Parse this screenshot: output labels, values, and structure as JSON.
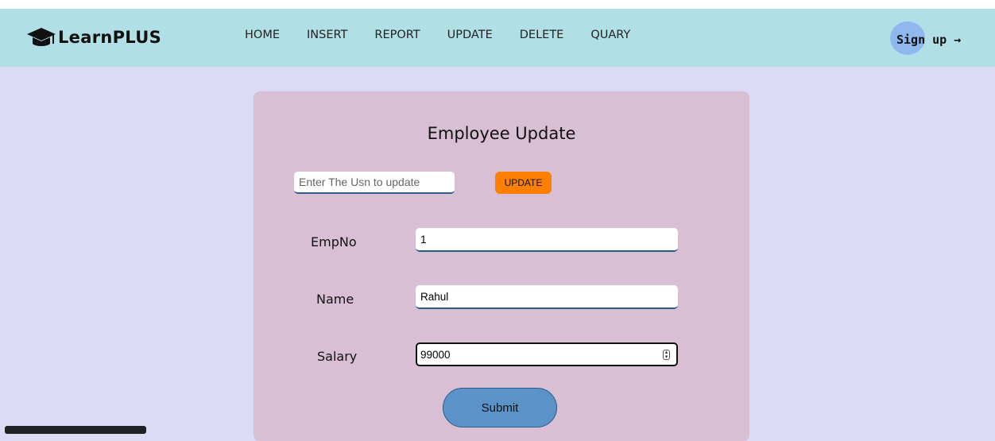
{
  "brand": {
    "name": "LearnPLUS",
    "icon": "graduation-cap-icon"
  },
  "nav": {
    "items": [
      "HOME",
      "INSERT",
      "REPORT",
      "UPDATE",
      "DELETE",
      "QUARY"
    ]
  },
  "signup": {
    "label": "Sign up →"
  },
  "form": {
    "title": "Employee Update",
    "usn_placeholder": "Enter The Usn to update",
    "update_label": "UPDATE",
    "fields": [
      {
        "label": "EmpNo",
        "value": "1"
      },
      {
        "label": "Name",
        "value": "Rahul"
      },
      {
        "label": "Salary",
        "value": "99000"
      }
    ],
    "submit_label": "Submit"
  },
  "colors": {
    "page_bg": "#dcdaf5",
    "navbar_bg": "#b0e0e6",
    "card_bg": "#d9bfd3",
    "update_button": "#ff8000",
    "submit_button": "#5b93c8",
    "signup_accent": "#8eb8ee"
  }
}
